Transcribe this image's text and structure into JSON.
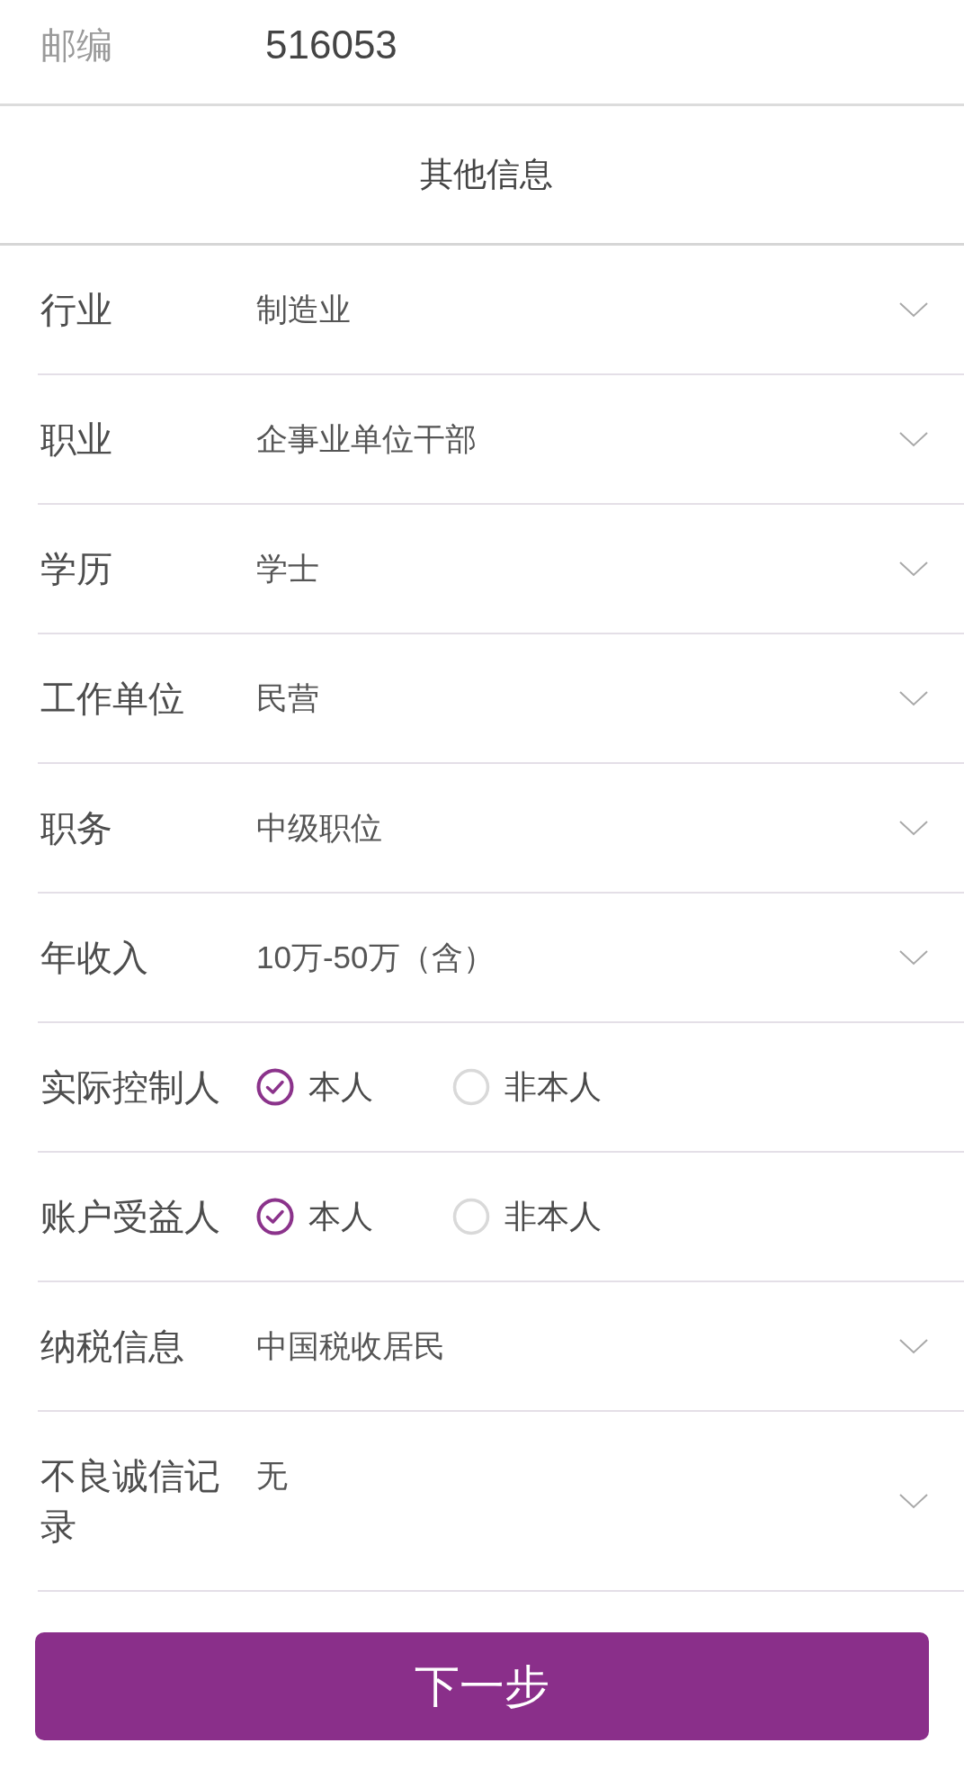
{
  "postal_code": {
    "label": "邮编",
    "value": "516053"
  },
  "section_title": "其他信息",
  "fields": [
    {
      "kind": "select",
      "label": "行业",
      "value": "制造业"
    },
    {
      "kind": "select",
      "label": "职业",
      "value": "企事业单位干部"
    },
    {
      "kind": "select",
      "label": "学历",
      "value": "学士"
    },
    {
      "kind": "select",
      "label": "工作单位",
      "value": "民营"
    },
    {
      "kind": "select",
      "label": "职务",
      "value": "中级职位"
    },
    {
      "kind": "select",
      "label": "年收入",
      "value": "10万-50万（含）"
    },
    {
      "kind": "radio",
      "label": "实际控制人",
      "options": [
        {
          "label": "本人",
          "selected": true
        },
        {
          "label": "非本人",
          "selected": false
        }
      ]
    },
    {
      "kind": "radio",
      "label": "账户受益人",
      "options": [
        {
          "label": "本人",
          "selected": true
        },
        {
          "label": "非本人",
          "selected": false
        }
      ]
    },
    {
      "kind": "select",
      "label": "纳税信息",
      "value": "中国税收居民"
    },
    {
      "kind": "select",
      "label": "不良诚信记录",
      "value": "无"
    }
  ],
  "next_button": "下一步"
}
